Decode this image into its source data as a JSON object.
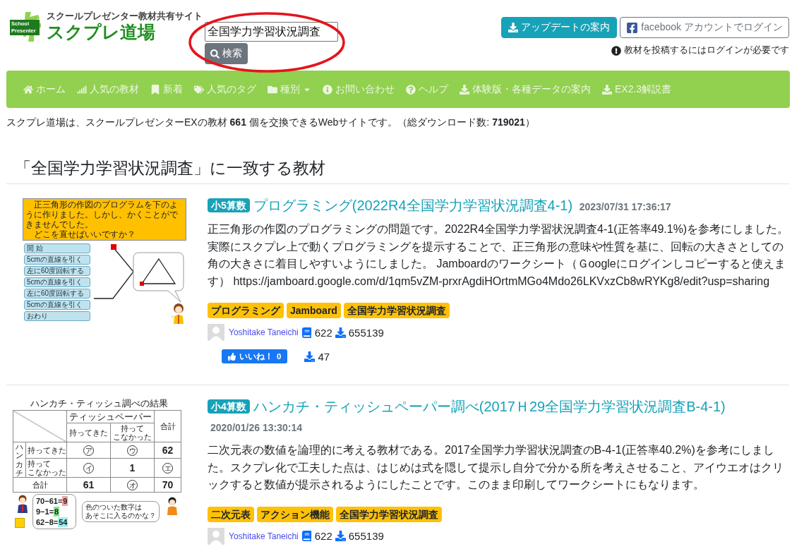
{
  "header": {
    "logo": {
      "badge_lines": [
        "School",
        "Presenter"
      ],
      "tagline": "スクールプレゼンター教材共有サイト",
      "title": "スクプレ道場"
    },
    "search": {
      "value": "全国学力学習状況調査",
      "button": "検索",
      "highlighted": true
    },
    "update_button": "アップデートの案内",
    "login_button": "facebook アカウントでログイン",
    "login_notice": "教材を投稿するにはログインが必要です"
  },
  "nav": [
    {
      "label": "ホーム",
      "dropdown": false
    },
    {
      "label": "人気の教材",
      "dropdown": false
    },
    {
      "label": "新着",
      "dropdown": false
    },
    {
      "label": "人気のタグ",
      "dropdown": false
    },
    {
      "label": "種別",
      "dropdown": true
    },
    {
      "label": "お問い合わせ",
      "dropdown": false
    },
    {
      "label": "ヘルプ",
      "dropdown": false
    },
    {
      "label": "体験版・各種データの案内",
      "dropdown": false
    },
    {
      "label": "EX2.3解説書",
      "dropdown": false
    }
  ],
  "intro": "スクプレ道場は、スクールプレゼンターEXの教材 **661** 個を交換できるWebサイトです。（総ダウンロード数: **719021**）",
  "results_heading": "「全国学力学習状況調査」に一致する教材",
  "results": [
    {
      "grade": "小5算数",
      "title": "プログラミング(2022R4全国学力学習状況調査4-1)",
      "date": "2023/07/31 17:36:17",
      "description": "正三角形の作図のプログラミングの問題です。2022R4全国学力学習状況調査4-1(正答率49.1%)を参考にしました。実際にスクプレ上で動くプログラミングを提示することで、正三角形の意味や性質を基に、回転の大きさとしての角の大きさに着目しやすいようにしました。 Jamboardのワークシート（Ｇoogleにログインしコピーすると使えます） https://jamboard.google.com/d/1qm5vZM-prxrAgdiHOrtmMGo4Mdo26LKVxzCb8wRYKg8/edit?usp=sharing",
      "tags": [
        "プログラミング",
        "Jamboard",
        "全国学力学習状況調査"
      ],
      "author": "Yoshitake Taneichi",
      "author_materials": "622",
      "author_downloads": "655139",
      "like_label": "いいね！",
      "like_count": "0",
      "downloads": "47",
      "thumbnail": {
        "kind": "program",
        "question": "正三角形の作図のプログラムを下のように作りました。しかし、かくことができませんでした。",
        "prompt": "どこを直せばいいですか？",
        "blocks": [
          "開 始",
          "5cmの直線を引く",
          "左に60度回転する",
          "5cmの直線を引く",
          "左に60度回転する",
          "5cmの直線を引く",
          "おわり"
        ]
      }
    },
    {
      "grade": "小4算数",
      "title": "ハンカチ・ティッシュペーパー調べ(2017Ｈ29全国学力学習状況調査B-4-1)",
      "date": "2020/01/26 13:30:14",
      "description": "二次元表の数値を論理的に考える教材である。2017全国学力学習状況調査のB-4-1(正答率40.2%)を参考にしました。スクプレ化で工夫した点は、はじめは式を隠して提示し自分で分かる所を考えさせること、アイウエオはクリックすると数値が提示されるようにしたことです。このまま印刷してワークシートにもなります。",
      "tags": [
        "二次元表",
        "アクション機能",
        "全国学力学習状況調査"
      ],
      "author": "Yoshitake Taneichi",
      "author_materials": "622",
      "author_downloads": "655139",
      "thumbnail": {
        "kind": "table",
        "title": "ハンカチ・ティッシュ調べの結果",
        "group_header": "ティッシュペーパー",
        "total_header": "合計",
        "sub_headers": [
          [
            "持ってきた"
          ],
          [
            "持って",
            "こなかった"
          ]
        ],
        "row_group": "ハンカチ",
        "rows": [
          {
            "label": [
              "持ってきた"
            ],
            "cells": [
              {
                "text": "ア",
                "circled": true
              },
              {
                "text": "ウ",
                "circled": true
              },
              {
                "text": "62",
                "circled": false
              }
            ]
          },
          {
            "label": [
              "持って",
              "こなかった"
            ],
            "cells": [
              {
                "text": "イ",
                "circled": true
              },
              {
                "text": "1",
                "circled": false
              },
              {
                "text": "エ",
                "circled": true
              }
            ]
          }
        ],
        "total_row": {
          "label": "合計",
          "cells": [
            {
              "text": "61",
              "circled": false
            },
            {
              "text": "オ",
              "circled": true
            },
            {
              "text": "70",
              "circled": false
            }
          ]
        },
        "equations": [
          {
            "expression": "70−61=",
            "answer": "9",
            "color": "#f4a3a3"
          },
          {
            "expression": "9−1=",
            "answer": "8",
            "color": "#8fe08f"
          },
          {
            "expression": "62−8=",
            "answer": "54",
            "color": "#9cefef"
          }
        ],
        "speech": [
          "色のついた数字は",
          "あそこに入るのかな？"
        ]
      }
    }
  ]
}
